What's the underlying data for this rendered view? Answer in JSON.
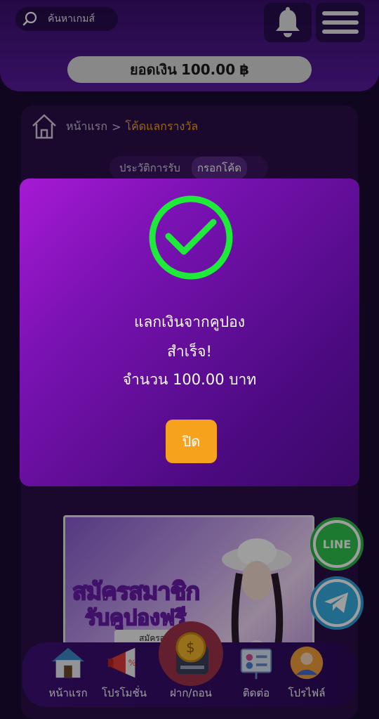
{
  "header": {
    "search_placeholder": "ค้นหาเกมส์",
    "balance_label": "ยอดเงิน",
    "balance_amount": "100.00",
    "currency_symbol": "฿"
  },
  "breadcrumb": {
    "home": "หน้าแรก",
    "separator": ">",
    "current": "โค้ดแลกรางวัล"
  },
  "tabs": [
    {
      "label": "ประวัติการรับ"
    },
    {
      "label": "กรอกโค้ด",
      "active": true
    }
  ],
  "modal": {
    "line1": "แลกเงินจากคูปอง",
    "line2": "สำเร็จ!",
    "line3": "จำนวน 100.00 บาท",
    "close_label": "ปิด",
    "status_icon": "check-circle-icon",
    "accent_color": "#1eea3a",
    "button_color": "#f7a21c"
  },
  "banner": {
    "title_line1": "สมัครสมาชิก",
    "title_line2": "รับคูปองฟรี",
    "subtitle": "สมัครสมาชิ"
  },
  "contacts": {
    "line_label": "LINE"
  },
  "bottom_nav": [
    {
      "label": "หน้าแรก",
      "icon": "home-icon"
    },
    {
      "label": "โปรโมชั่น",
      "icon": "megaphone-icon"
    },
    {
      "label": "ฝาก/ถอน",
      "icon": "coin-icon"
    },
    {
      "label": "ติดต่อ",
      "icon": "contact-board-icon"
    },
    {
      "label": "โปรไฟล์",
      "icon": "profile-icon"
    }
  ]
}
